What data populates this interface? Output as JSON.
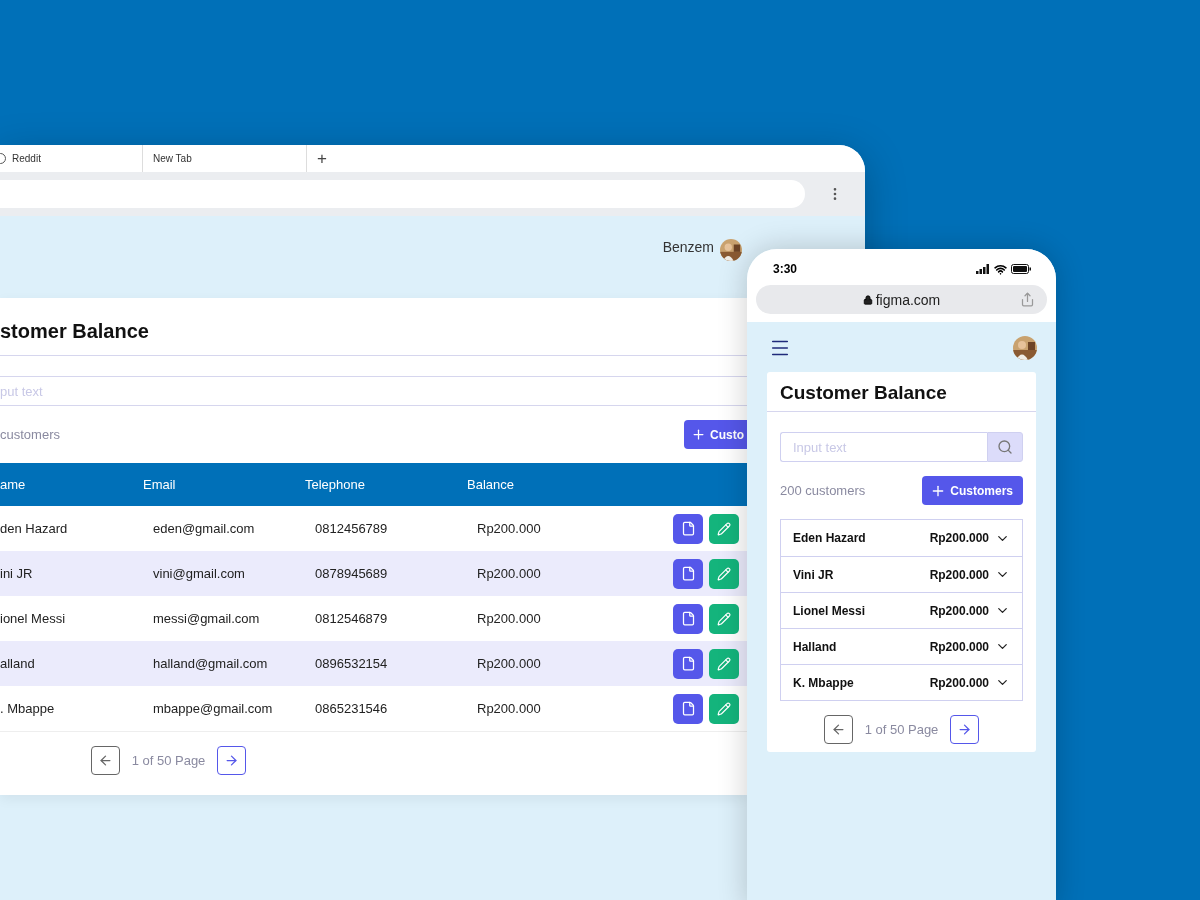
{
  "browser": {
    "tabs": [
      {
        "label": "Reddit"
      },
      {
        "label": "New Tab"
      }
    ],
    "new_tab": "+",
    "user_name": "Benzem",
    "card": {
      "title": "stomer Balance",
      "search_placeholder": "put text",
      "count": "customers",
      "add_button": "Custo",
      "columns": [
        "ame",
        "Email",
        "Telephone",
        "Balance"
      ],
      "rows": [
        {
          "name": "den Hazard",
          "email": "eden@gmail.com",
          "telephone": "0812456789",
          "balance": "Rp200.000"
        },
        {
          "name": "ini JR",
          "email": "vini@gmail.com",
          "telephone": "0878945689",
          "balance": "Rp200.000"
        },
        {
          "name": "ionel Messi",
          "email": "messi@gmail.com",
          "telephone": "0812546879",
          "balance": "Rp200.000"
        },
        {
          "name": "alland",
          "email": "halland@gmail.com",
          "telephone": "0896532154",
          "balance": "Rp200.000"
        },
        {
          "name": ". Mbappe",
          "email": "mbappe@gmail.com",
          "telephone": "0865231546",
          "balance": "Rp200.000"
        }
      ],
      "pagination": "1 of 50 Page"
    }
  },
  "phone": {
    "time": "3:30",
    "url": "figma.com",
    "card": {
      "title": "Customer Balance",
      "search_placeholder": "Input text",
      "count": "200 customers",
      "add_button": "Customers",
      "rows": [
        {
          "name": "Eden Hazard",
          "balance": "Rp200.000"
        },
        {
          "name": "Vini JR",
          "balance": "Rp200.000"
        },
        {
          "name": "Lionel Messi",
          "balance": "Rp200.000"
        },
        {
          "name": "Halland",
          "balance": "Rp200.000"
        },
        {
          "name": "K. Mbappe",
          "balance": "Rp200.000"
        }
      ],
      "pagination": "1 of 50 Page"
    }
  }
}
